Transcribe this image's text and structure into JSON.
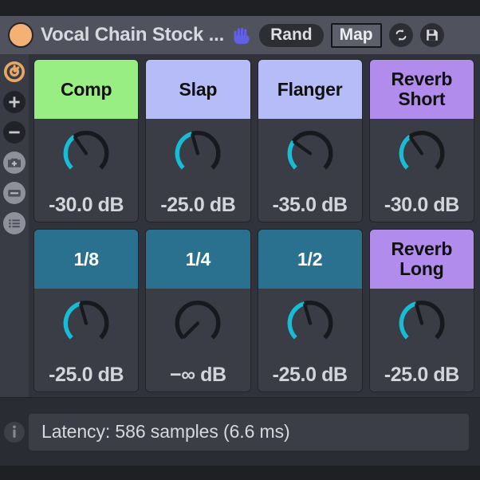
{
  "window": {
    "accent_color": "#f3b173",
    "title": "Vocal Chain Stock ...",
    "hand_icon": "hand-icon",
    "rand_label": "Rand",
    "map_label": "Map",
    "refresh_icon": "refresh-icon",
    "save_icon": "save-disk-icon"
  },
  "sidebar": {
    "items": [
      {
        "name": "macro-snapshot-icon",
        "icon": "power-circle-icon",
        "style": "accent"
      },
      {
        "name": "add-macro-button",
        "icon": "plus-icon",
        "style": "dark"
      },
      {
        "name": "remove-macro-button",
        "icon": "minus-icon",
        "style": "dark"
      },
      {
        "name": "snapshot-button",
        "icon": "camera-plus-icon",
        "style": "grey"
      },
      {
        "name": "rename-button",
        "icon": "card-icon",
        "style": "grey"
      },
      {
        "name": "list-view-button",
        "icon": "list-icon",
        "style": "grey"
      }
    ]
  },
  "macros": {
    "rows": [
      [
        {
          "label": "Comp",
          "value": "-30.0 dB",
          "color": "#98ee82",
          "text_color": "#101010",
          "knob_pct": 0.37
        },
        {
          "label": "Slap",
          "value": "-25.0 dB",
          "color": "#b6bcf7",
          "text_color": "#101010",
          "knob_pct": 0.44
        },
        {
          "label": "Flanger",
          "value": "-35.0 dB",
          "color": "#b6bcf7",
          "text_color": "#101010",
          "knob_pct": 0.3
        },
        {
          "label": "Reverb Short",
          "value": "-30.0 dB",
          "color": "#b18cec",
          "text_color": "#101010",
          "knob_pct": 0.37
        }
      ],
      [
        {
          "label": "1/8",
          "value": "-25.0 dB",
          "color": "#2a718f",
          "text_color": "#ffffff",
          "knob_pct": 0.44
        },
        {
          "label": "1/4",
          "value": "−∞ dB",
          "color": "#2a718f",
          "text_color": "#ffffff",
          "knob_pct": 0.0
        },
        {
          "label": "1/2",
          "value": "-25.0 dB",
          "color": "#2a718f",
          "text_color": "#ffffff",
          "knob_pct": 0.44
        },
        {
          "label": "Reverb Long",
          "value": "-25.0 dB",
          "color": "#b18cec",
          "text_color": "#101010",
          "knob_pct": 0.44
        }
      ]
    ],
    "knob_fill_color": "#19bcd4",
    "knob_track_color": "#17191d"
  },
  "footer": {
    "info_icon": "info-icon",
    "latency_text": "Latency: 586 samples (6.6 ms)"
  }
}
